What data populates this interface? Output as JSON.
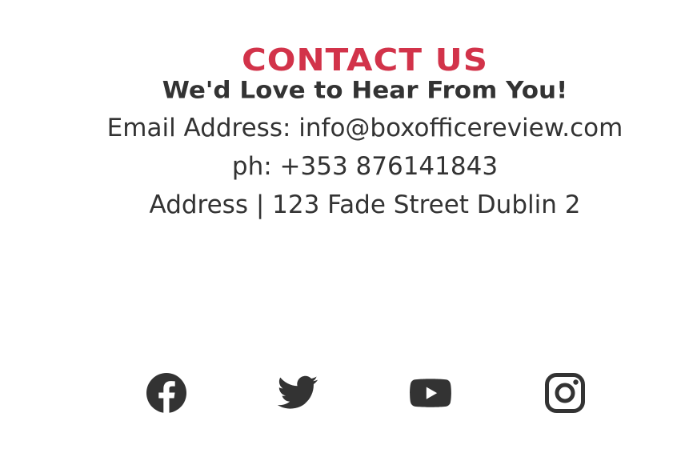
{
  "contact": {
    "title": "CONTACT US",
    "subtitle": "We'd Love to Hear From You!",
    "email_line": "Email Address: info@boxofficereview.com",
    "phone_line": "ph: +353 876141843",
    "address_line": "Address | 123 Fade Street Dublin 2"
  },
  "colors": {
    "title": "#d2334a",
    "text": "#333333",
    "icons": "#333333",
    "background": "#ffffff"
  },
  "social": [
    {
      "icon": "facebook-icon"
    },
    {
      "icon": "twitter-icon"
    },
    {
      "icon": "youtube-icon"
    },
    {
      "icon": "instagram-icon"
    }
  ]
}
